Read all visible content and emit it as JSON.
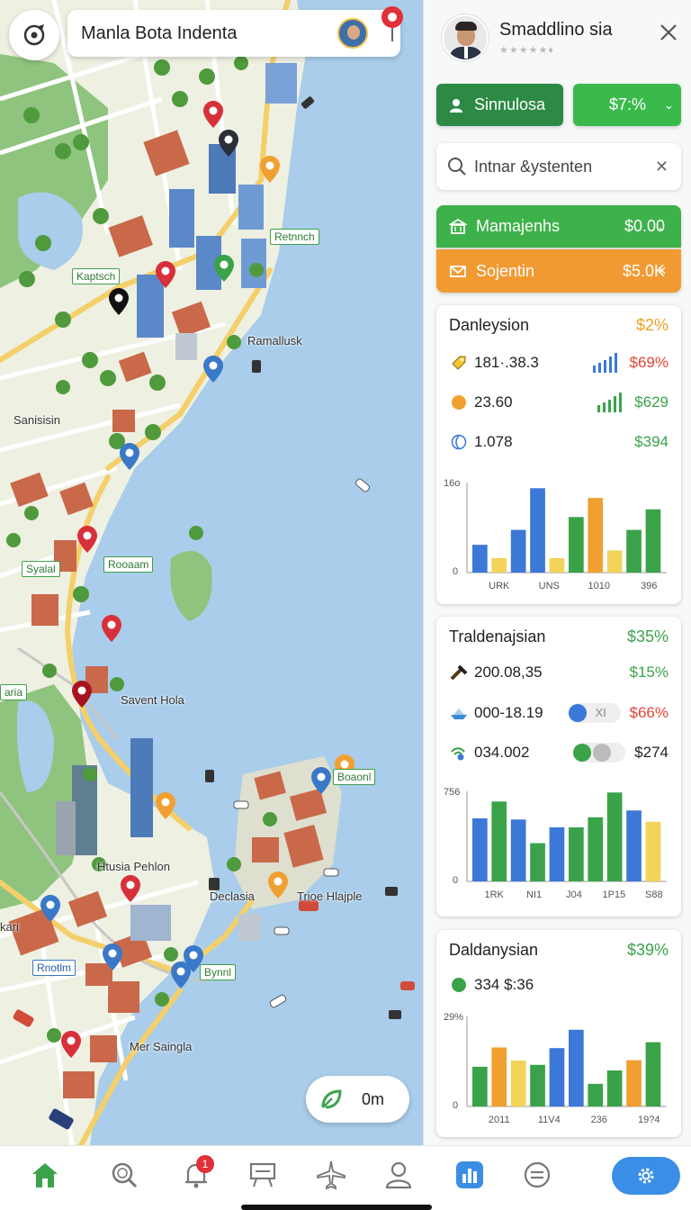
{
  "map": {
    "search_query": "Manla Bota Indenta",
    "distance": "0m",
    "labels": [
      "Ramallusk",
      "Sanisisin",
      "Savent Hola",
      "Htusia Pehlon",
      "Declasia",
      "Trioe Hlajple",
      "Mer Saingla",
      "kari",
      "aria"
    ],
    "tags": [
      "Retnnch",
      "Kaptsch",
      "Syalal",
      "Rooaam",
      "Boaonl",
      "Rnotlm",
      "Bynnl"
    ]
  },
  "profile": {
    "name": "Smaddlino sia",
    "rating": "★★★★★♦"
  },
  "actions": {
    "simulation_label": "Sinnulosa",
    "percent_label": "$7:%"
  },
  "panel_search": {
    "placeholder": "Intnar &ystenten"
  },
  "accounts": {
    "green": {
      "label": "Mamajenhs",
      "amount": "$0.00"
    },
    "orange": {
      "label": "Sojentin",
      "amount": "$5.0K"
    }
  },
  "cards": [
    {
      "title": "Danleysion",
      "percent": "$2%",
      "metrics": [
        {
          "value": "181·.38.3",
          "amount": "$69%"
        },
        {
          "value": "23.60",
          "amount": "$629"
        },
        {
          "value": "1.078",
          "amount": "$394"
        }
      ],
      "chart_data": {
        "type": "bar",
        "y_tick_top": "16o",
        "y_tick_zero": "0",
        "x_ticks": [
          "URK",
          "UNS",
          "1010",
          "396"
        ],
        "bars": [
          {
            "value": 5.4,
            "color": "#3b78d8"
          },
          {
            "value": 2.8,
            "color": "#f3d35a"
          },
          {
            "value": 8.3,
            "color": "#3b78d8"
          },
          {
            "value": 16.4,
            "color": "#3b78d8"
          },
          {
            "value": 2.8,
            "color": "#f3d35a"
          },
          {
            "value": 10.8,
            "color": "#3aa34a"
          },
          {
            "value": 14.5,
            "color": "#f0a030"
          },
          {
            "value": 4.3,
            "color": "#f3d35a"
          },
          {
            "value": 8.3,
            "color": "#3aa34a"
          },
          {
            "value": 12.3,
            "color": "#3aa34a"
          }
        ],
        "ylim": [
          0,
          17.5
        ]
      }
    },
    {
      "title": "Traldenajsian",
      "percent": "$35%",
      "metrics": [
        {
          "value": "200.08,35",
          "amount": "$15%"
        },
        {
          "value": "000-18.19",
          "amount": "$66%",
          "toggle_text": "XI"
        },
        {
          "value": "034.002",
          "amount": "$274"
        }
      ],
      "chart_data": {
        "type": "bar",
        "y_tick_top": "756",
        "y_tick_zero": "0",
        "x_ticks": [
          "1RK",
          "NI1",
          "J04",
          "1P15",
          "S88"
        ],
        "bars": [
          {
            "value": 5.6,
            "color": "#3b78d8"
          },
          {
            "value": 7.1,
            "color": "#3aa34a"
          },
          {
            "value": 5.5,
            "color": "#3b78d8"
          },
          {
            "value": 3.4,
            "color": "#3aa34a"
          },
          {
            "value": 4.8,
            "color": "#3b78d8"
          },
          {
            "value": 4.8,
            "color": "#3aa34a"
          },
          {
            "value": 5.7,
            "color": "#3aa34a"
          },
          {
            "value": 7.9,
            "color": "#3aa34a"
          },
          {
            "value": 6.3,
            "color": "#3b78d8"
          },
          {
            "value": 5.3,
            "color": "#f3d35a"
          }
        ],
        "ylim": [
          0,
          8
        ]
      }
    },
    {
      "title": "Daldanysian",
      "percent": "$39%",
      "metrics": [
        {
          "value": "334 $:36"
        }
      ],
      "chart_data": {
        "type": "bar",
        "y_tick_top": "29%",
        "y_tick_zero": "0",
        "x_ticks": [
          "2011",
          "11V4",
          "236",
          "19?4"
        ],
        "bars": [
          {
            "value": 12.8,
            "color": "#3aa34a"
          },
          {
            "value": 19.0,
            "color": "#f0a030"
          },
          {
            "value": 14.8,
            "color": "#f3d35a"
          },
          {
            "value": 13.4,
            "color": "#3aa34a"
          },
          {
            "value": 18.8,
            "color": "#3b78d8"
          },
          {
            "value": 24.7,
            "color": "#3b78d8"
          },
          {
            "value": 7.3,
            "color": "#3aa34a"
          },
          {
            "value": 11.6,
            "color": "#3aa34a"
          },
          {
            "value": 14.9,
            "color": "#f0a030"
          },
          {
            "value": 20.7,
            "color": "#3aa34a"
          }
        ],
        "ylim": [
          0,
          29
        ]
      }
    }
  ],
  "nav": {
    "notification_count": "1",
    "items": [
      "home-icon",
      "search-icon",
      "bell-icon",
      "board-icon",
      "flight-icon",
      "person-icon",
      "stats-icon",
      "menu-icon",
      "gear-icon"
    ],
    "active": "stats-icon",
    "accent": "#3a8ee6"
  }
}
